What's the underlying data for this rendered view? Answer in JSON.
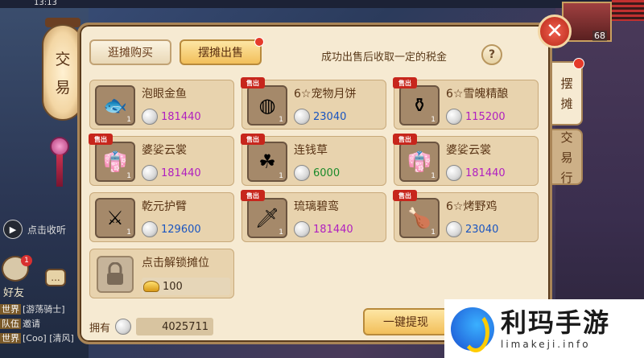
{
  "status": {
    "time": "13:13"
  },
  "side": {
    "lantern_chars": [
      "交",
      "易"
    ],
    "chat_toggle_label": "点击收听",
    "friend_label": "好友",
    "friend_badge": "1",
    "chat_icon_label": "...",
    "chat_lines": [
      {
        "tag": "世界",
        "text": "[游荡骑士]"
      },
      {
        "tag": "队伍",
        "text": "邀请"
      },
      {
        "tag": "世界",
        "text": "[Coo] [清风]"
      }
    ]
  },
  "player": {
    "level": "68"
  },
  "panel": {
    "tabs": [
      {
        "label": "逛摊购买",
        "active": false
      },
      {
        "label": "摆摊出售",
        "active": true,
        "has_dot": true
      }
    ],
    "tax_note": "成功出售后收取一定的税金",
    "help_label": "?",
    "items": [
      {
        "name": "泡眼金鱼",
        "price": "181440",
        "price_color": "purple",
        "qty": "1",
        "sold": false,
        "icon": "fish-icon",
        "glyph": "🐟"
      },
      {
        "name": "6☆宠物月饼",
        "price": "23040",
        "price_color": "blue",
        "qty": "1",
        "sold": true,
        "icon": "mooncake-icon",
        "glyph": "◍"
      },
      {
        "name": "6☆雪魄精酿",
        "price": "115200",
        "price_color": "purple",
        "qty": "1",
        "sold": true,
        "icon": "wine-jar-icon",
        "glyph": "⚱"
      },
      {
        "name": "婆娑云裳",
        "price": "181440",
        "price_color": "purple",
        "qty": "1",
        "sold": true,
        "icon": "robe-icon",
        "glyph": "👘"
      },
      {
        "name": "连钱草",
        "price": "6000",
        "price_color": "green",
        "qty": "1",
        "sold": true,
        "icon": "herb-icon",
        "glyph": "☘"
      },
      {
        "name": "婆娑云裳",
        "price": "181440",
        "price_color": "purple",
        "qty": "1",
        "sold": true,
        "icon": "robe-icon",
        "glyph": "👘"
      },
      {
        "name": "乾元护臂",
        "price": "129600",
        "price_color": "blue",
        "qty": "1",
        "sold": false,
        "icon": "bracer-icon",
        "glyph": "⚔"
      },
      {
        "name": "琉璃碧鸾",
        "price": "181440",
        "price_color": "purple",
        "qty": "1",
        "sold": true,
        "icon": "weapon-icon",
        "glyph": "🗡"
      },
      {
        "name": "6☆烤野鸡",
        "price": "23040",
        "price_color": "blue",
        "qty": "1",
        "sold": true,
        "icon": "roast-food-icon",
        "glyph": "🍗"
      }
    ],
    "sold_tag": "售出",
    "lock": {
      "label": "点击解锁摊位",
      "cost": "100"
    },
    "own_label": "拥有",
    "own_value": "4025711",
    "withdraw_label": "一键提现",
    "side_tabs": [
      {
        "label": [
          "摆",
          "摊"
        ]
      },
      {
        "label": [
          "交",
          "易",
          "行"
        ]
      }
    ]
  },
  "watermark": {
    "cn": "利玛手游",
    "en": "limakeji.info"
  },
  "colors": {
    "purple": "#b01fc0",
    "blue": "#1a55c0",
    "green": "#1a8a2a",
    "gold": "#f2bf5a",
    "parchment": "#f6ead2"
  }
}
